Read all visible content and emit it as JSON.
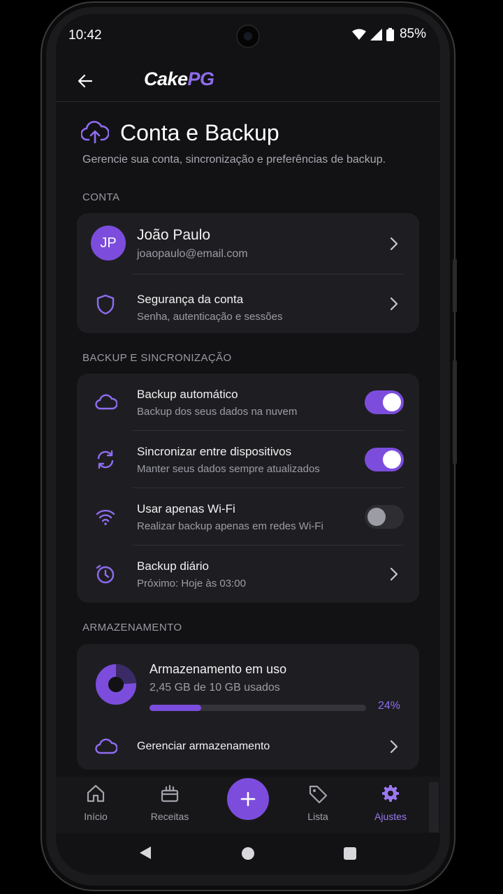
{
  "status_bar": {
    "time": "10:42",
    "battery": "85%"
  },
  "app_bar": {
    "logo_main": "Cake",
    "logo_accent": "PG"
  },
  "header": {
    "title": "Conta e Backup",
    "subtitle": "Gerencie sua conta, sincronização e preferências de backup."
  },
  "account": {
    "section": "CONTA",
    "profile": {
      "initials": "JP",
      "name": "João Paulo",
      "email": "joaopaulo@email.com"
    },
    "security": {
      "title": "Segurança da conta",
      "subtitle": "Senha, autenticação e sessões"
    }
  },
  "backup": {
    "section": "BACKUP E SINCRONIZAÇÃO",
    "items": [
      {
        "title": "Backup automático",
        "subtitle": "Backup dos seus dados na nuvem",
        "enabled": true
      },
      {
        "title": "Sincronizar entre dispositivos",
        "subtitle": "Manter seus dados sempre atualizados",
        "enabled": true
      },
      {
        "title": "Usar apenas Wi-Fi",
        "subtitle": "Realizar backup apenas em redes Wi-Fi",
        "enabled": false
      }
    ],
    "schedule": {
      "title": "Backup diário",
      "subtitle": "Próximo: Hoje às 03:00"
    }
  },
  "storage": {
    "section": "ARMAZENAMENTO",
    "title": "Armazenamento em uso",
    "usage": "2,45 GB de 10 GB usados",
    "percent_label": "24%",
    "fraction": 0.24,
    "manage": "Gerenciar armazenamento"
  },
  "bottom_nav": {
    "items": [
      {
        "label": "Início",
        "icon": "home-icon"
      },
      {
        "label": "Receitas",
        "icon": "recipe-box-icon"
      },
      {
        "label": "Lista",
        "icon": "tag-icon"
      },
      {
        "label": "Ajustes",
        "icon": "gear-icon",
        "active": true
      }
    ],
    "fab_icon": "plus-icon"
  },
  "colors": {
    "accent": "#7c4ddc",
    "accent_light": "#8f6cf0",
    "background": "#121214",
    "card": "#1e1e22"
  }
}
